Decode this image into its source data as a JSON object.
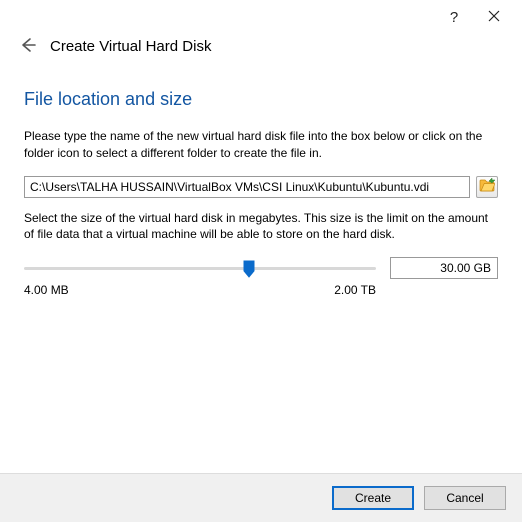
{
  "titlebar": {
    "help": "?",
    "close": "✕"
  },
  "header": {
    "title": "Create Virtual Hard Disk"
  },
  "section": {
    "title": "File location and size"
  },
  "desc1": "Please type the name of the new virtual hard disk file into the box below or click on the folder icon to select a different folder to create the file in.",
  "path": {
    "value": "C:\\Users\\TALHA HUSSAIN\\VirtualBox VMs\\CSI Linux\\Kubuntu\\Kubuntu.vdi"
  },
  "desc2": "Select the size of the virtual hard disk in megabytes. This size is the limit on the amount of file data that a virtual machine will be able to store on the hard disk.",
  "size": {
    "value": "30.00 GB",
    "min_label": "4.00 MB",
    "max_label": "2.00 TB"
  },
  "buttons": {
    "create": "Create",
    "cancel": "Cancel"
  }
}
